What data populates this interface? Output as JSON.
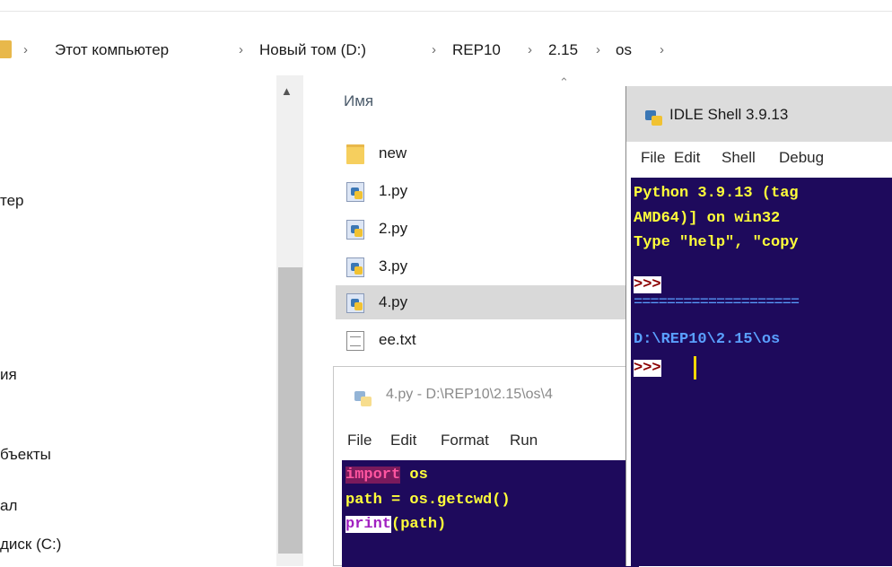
{
  "breadcrumb": {
    "items": [
      "Этот компьютер",
      "Новый том (D:)",
      "REP10",
      "2.15",
      "os"
    ],
    "separator": "›"
  },
  "nav_pane": {
    "items": [
      "тер",
      "ия",
      "бъекты",
      "ал",
      "диск (C:)"
    ]
  },
  "file_list": {
    "column_name": "Имя",
    "files": [
      {
        "name": "new",
        "type": "folder"
      },
      {
        "name": "1.py",
        "type": "python"
      },
      {
        "name": "2.py",
        "type": "python"
      },
      {
        "name": "3.py",
        "type": "python"
      },
      {
        "name": "4.py",
        "type": "python",
        "selected": true
      },
      {
        "name": "ee.txt",
        "type": "text"
      }
    ]
  },
  "editor": {
    "title": "4.py - D:\\REP10\\2.15\\os\\4",
    "menu": [
      "File",
      "Edit",
      "Format",
      "Run"
    ],
    "code": {
      "line1_kw": "import",
      "line1_rest": " os",
      "line2": "path = os.getcwd()",
      "line3_fn": "print",
      "line3_rest": "(path)"
    }
  },
  "shell": {
    "title": "IDLE Shell 3.9.13",
    "menu": [
      "File",
      "Edit",
      "Shell",
      "Debug"
    ],
    "lines": {
      "l1": "Python 3.9.13 (tag",
      "l2": "AMD64)] on win32",
      "l3": "Type \"help\", \"copy",
      "prompt": ">>>",
      "restart": "====================",
      "output": "D:\\REP10\\2.15\\os"
    }
  },
  "colors": {
    "idle_bg": "#1e0a5c",
    "idle_text": "#ffff3a",
    "keyword": "#ff55a0",
    "output": "#5aa0ff",
    "selection": "#d9d9d9"
  }
}
